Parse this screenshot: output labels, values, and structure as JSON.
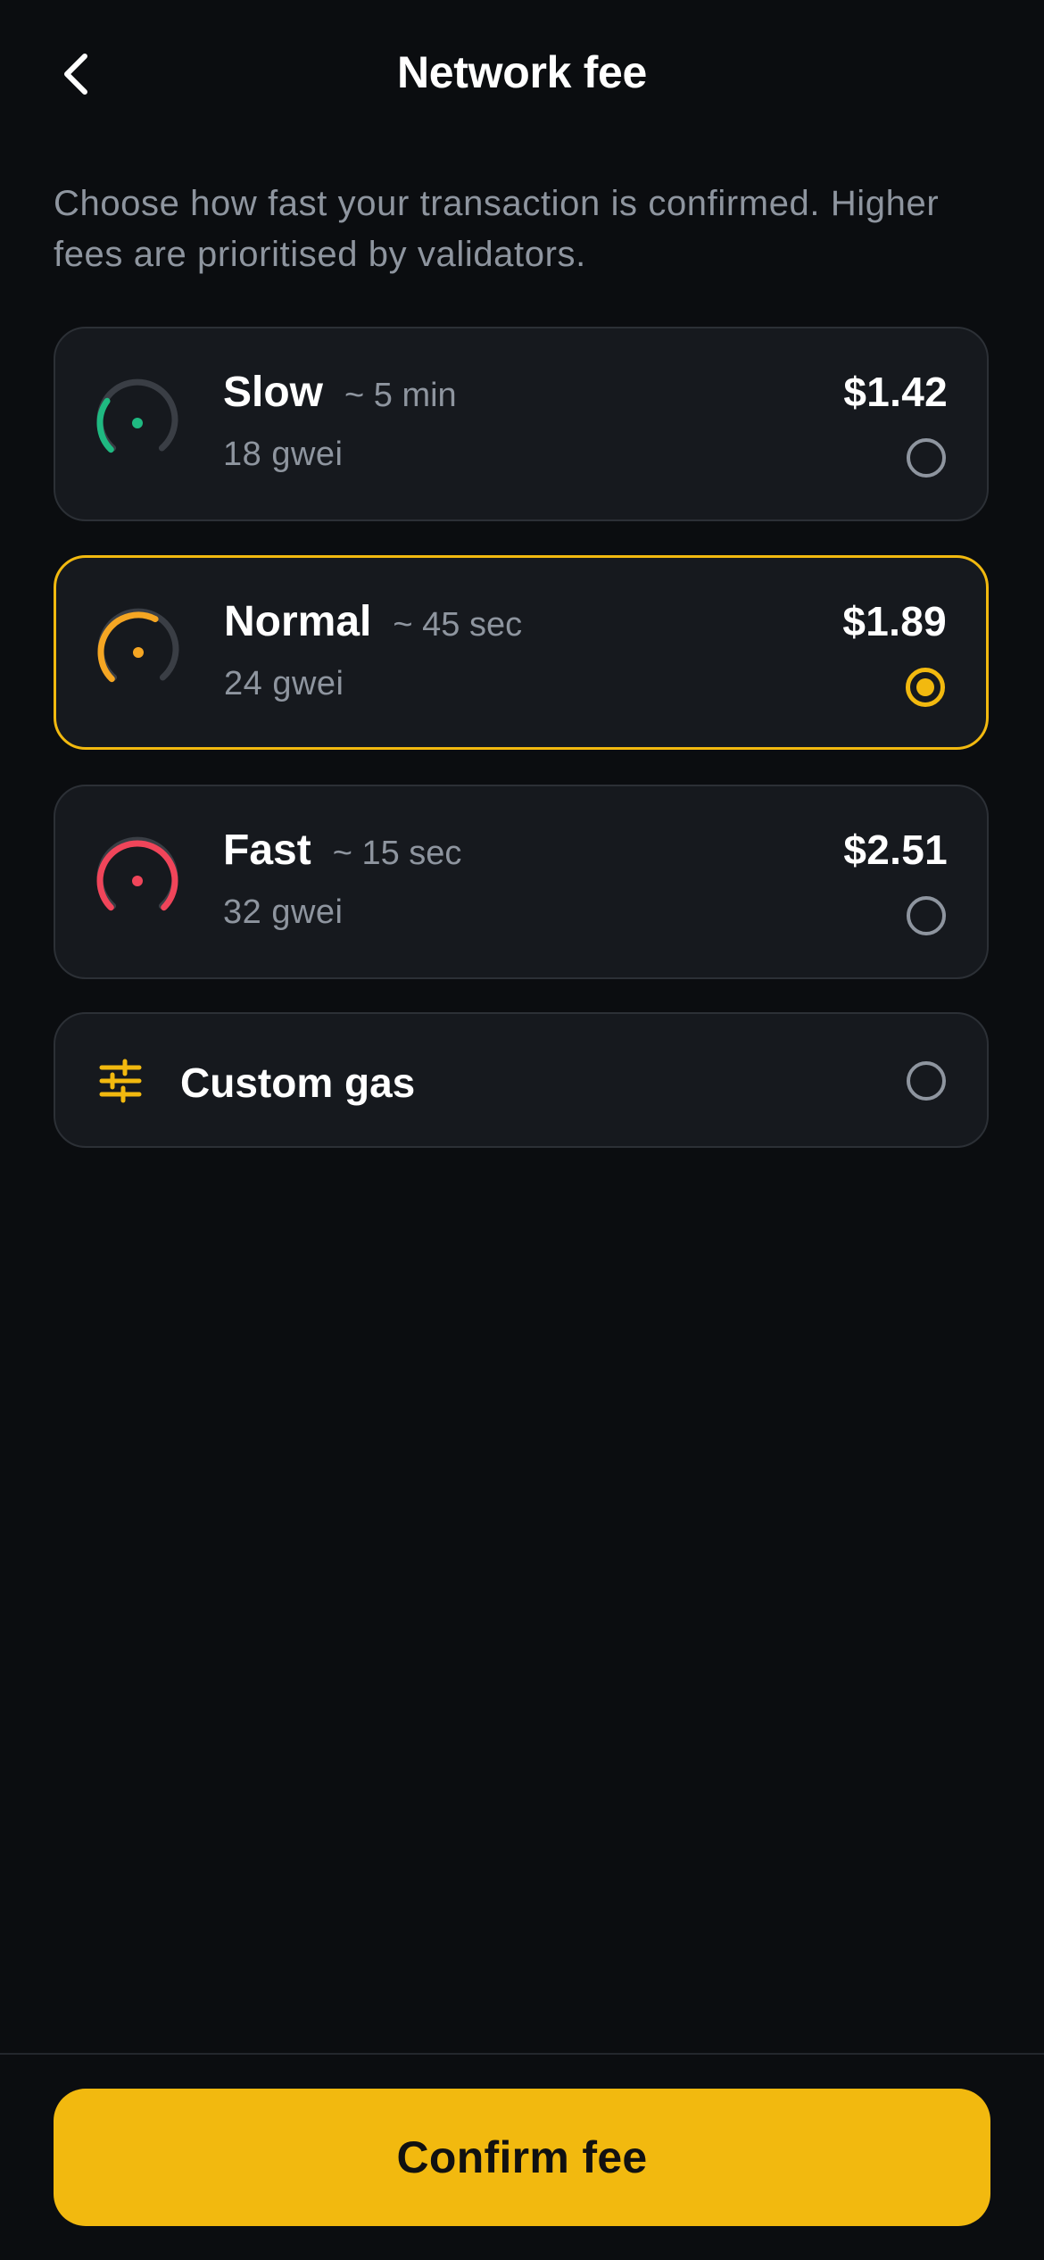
{
  "header": {
    "title": "Network fee",
    "back_icon": "chevron-left-icon"
  },
  "intro": "Choose how fast your transaction is confirmed. Higher fees are prioritised by validators.",
  "options": [
    {
      "name": "Slow",
      "eta": "~ 5 min",
      "gwei": "18 gwei",
      "price": "$1.42",
      "color": "#1fb981",
      "gauge_level": 0.3,
      "selected": false
    },
    {
      "name": "Normal",
      "eta": "~ 45 sec",
      "gwei": "24 gwei",
      "price": "$1.89",
      "color": "#f5a623",
      "gauge_level": 0.6,
      "selected": true
    },
    {
      "name": "Fast",
      "eta": "~ 15 sec",
      "gwei": "32 gwei",
      "price": "$2.51",
      "color": "#f0455a",
      "gauge_level": 1.0,
      "selected": false
    }
  ],
  "custom": {
    "label": "Custom gas",
    "icon": "sliders-icon",
    "selected": false
  },
  "footer": {
    "confirm_label": "Confirm fee"
  },
  "colors": {
    "accent": "#f2b90f",
    "background": "#0b0d10",
    "card": "#16191e",
    "muted_text": "#8e959f"
  }
}
